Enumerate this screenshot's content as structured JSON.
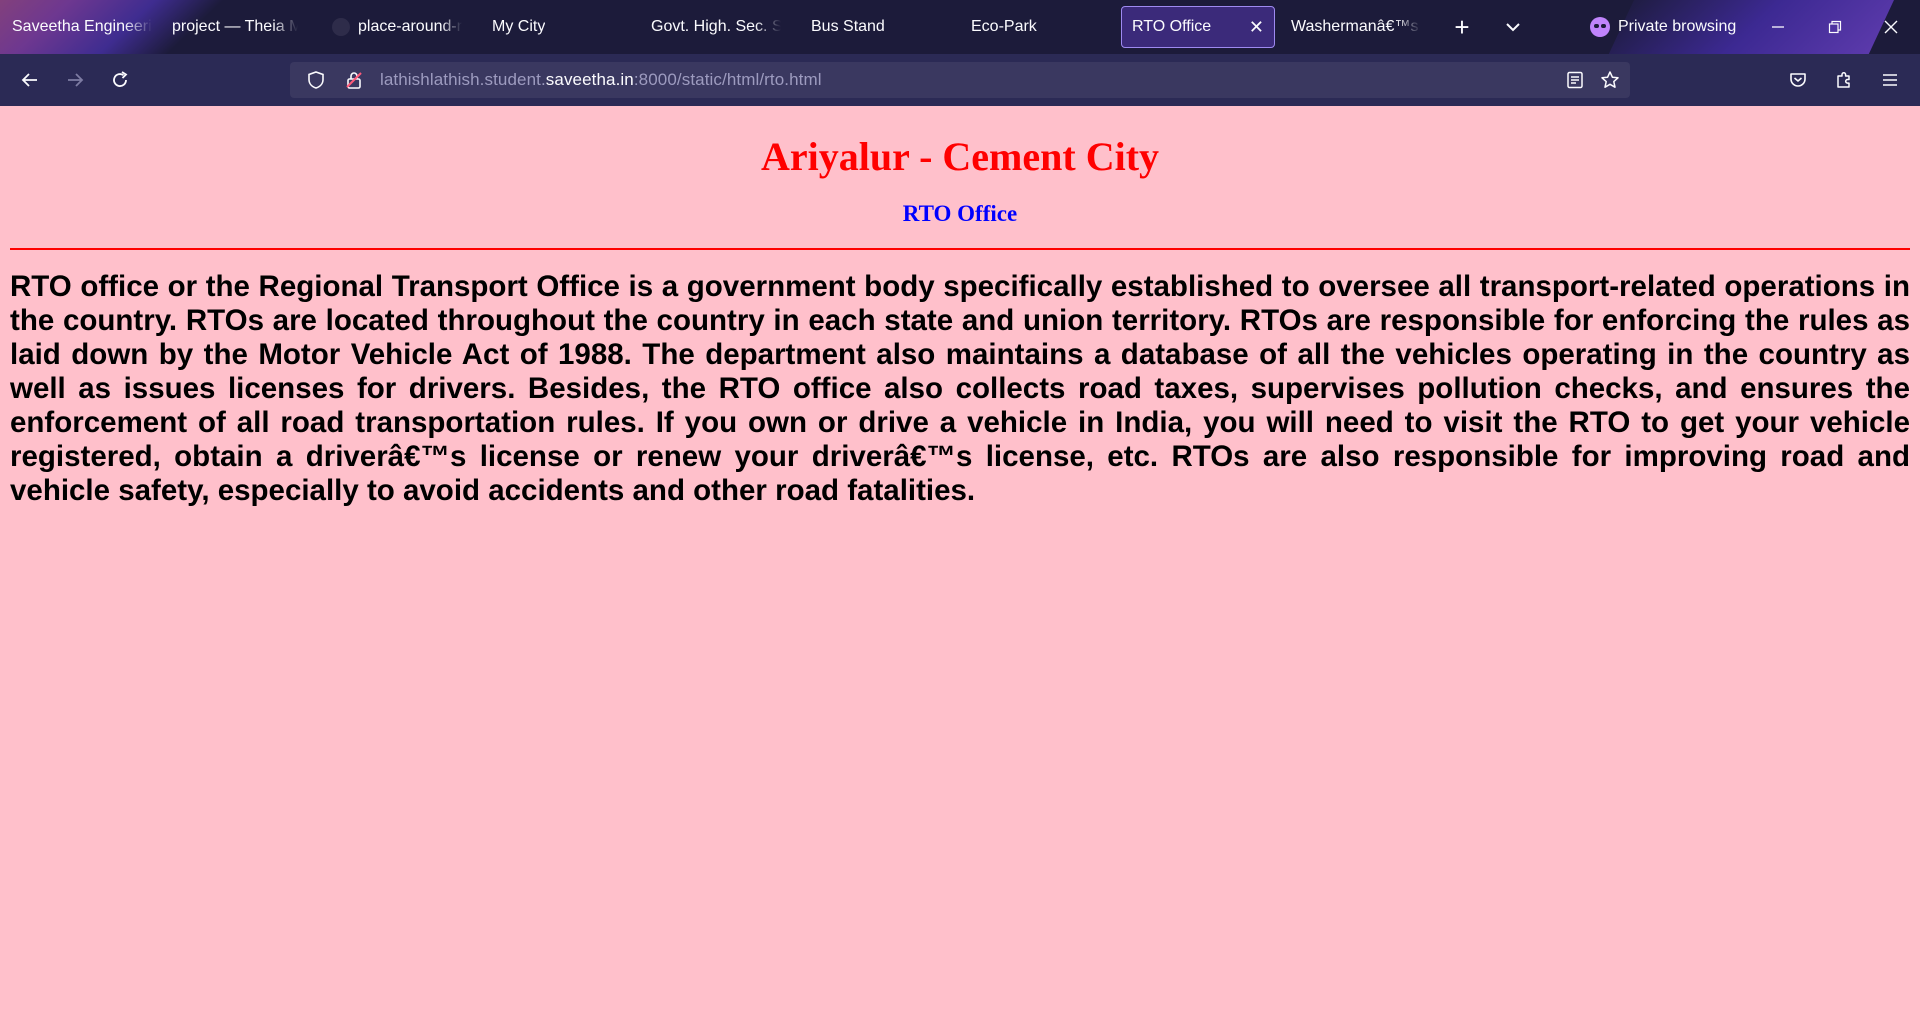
{
  "browser": {
    "tabs": [
      {
        "label": "Saveetha Engineering",
        "active": false
      },
      {
        "label": "project — Theia Multi",
        "active": false
      },
      {
        "label": "place-around-me",
        "active": false
      },
      {
        "label": "My City",
        "active": false
      },
      {
        "label": "Govt. High. Sec. School",
        "active": false
      },
      {
        "label": "Bus Stand",
        "active": false
      },
      {
        "label": "Eco-Park",
        "active": false
      },
      {
        "label": "RTO Office",
        "active": true
      },
      {
        "label": "Washermanâ€™s Lake",
        "active": false
      }
    ],
    "private_label": "Private browsing",
    "url_prefix": "lathishlathish.student.",
    "url_host": "saveetha.in",
    "url_suffix": ":8000/static/html/rto.html",
    "tab_close_glyph": "✕",
    "new_tab_glyph": "+",
    "list_tabs_glyph": "⌄",
    "accent_color": "#9e8af0"
  },
  "page": {
    "title": "Ariyalur - Cement City",
    "subtitle": "RTO Office",
    "body": "RTO office or the Regional Transport Office is a government body specifically established to oversee all transport-related operations in the country. RTOs are located throughout the country in each state and union territory. RTOs are responsible for enforcing the rules as laid down by the Motor Vehicle Act of 1988. The department also maintains a database of all the vehicles operating in the country as well as issues licenses for drivers. Besides, the RTO office also collects road taxes, supervises pollution checks, and ensures the enforcement of all road transportation rules. If you own or drive a vehicle in India, you will need to visit the RTO to get your vehicle registered, obtain a driverâ€™s license or renew your driverâ€™s license, etc. RTOs are also responsible for improving road and vehicle safety, especially to avoid accidents and other road fatalities.",
    "background_color": "#ffc0cb",
    "title_color": "#ff0000",
    "subtitle_color": "#0000ff"
  }
}
